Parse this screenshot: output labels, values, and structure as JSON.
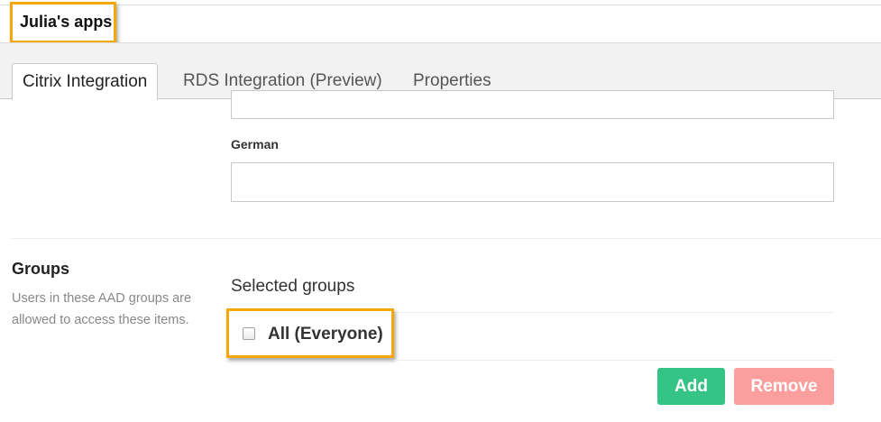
{
  "header": {
    "title": "Julia's apps"
  },
  "tabs": [
    {
      "label": "Citrix Integration",
      "active": true
    },
    {
      "label": "RDS Integration (Preview)",
      "active": false
    },
    {
      "label": "Properties",
      "active": false
    }
  ],
  "form": {
    "german_label": "German",
    "german_value": "",
    "previous_value": ""
  },
  "groups": {
    "title": "Groups",
    "description": "Users in these AAD groups are allowed to access these items.",
    "selected_label": "Selected groups",
    "items": [
      {
        "label": "All (Everyone)",
        "checked": false
      }
    ],
    "add_label": "Add",
    "remove_label": "Remove"
  },
  "colors": {
    "highlight": "#f6a800",
    "add_button": "#36c486",
    "remove_button": "#fa9e9e"
  }
}
